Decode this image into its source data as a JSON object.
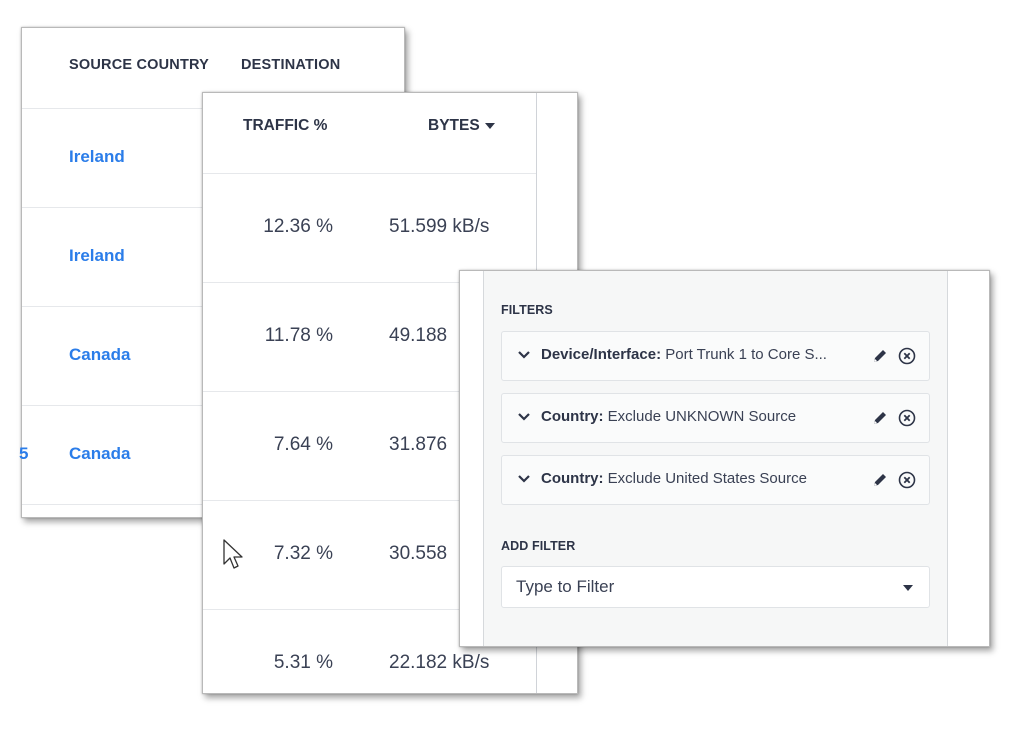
{
  "source_panel": {
    "headers": [
      "SOURCE COUNTRY",
      "DESTINATION"
    ],
    "rows": [
      {
        "country": "Ireland",
        "left_cut": ""
      },
      {
        "country": "Ireland",
        "left_cut": ""
      },
      {
        "country": "Canada",
        "left_cut": ""
      },
      {
        "country": "Canada",
        "left_cut": "5"
      }
    ]
  },
  "traffic_panel": {
    "headers": {
      "traffic": "TRAFFIC %",
      "bytes": "BYTES"
    },
    "sort_icon": "caret-down-icon",
    "rows": [
      {
        "traffic": "12.36 %",
        "bytes": "51.599 kB/s"
      },
      {
        "traffic": "11.78 %",
        "bytes": "49.188"
      },
      {
        "traffic": "7.64 %",
        "bytes": "31.876"
      },
      {
        "traffic": "7.32 %",
        "bytes": "30.558"
      },
      {
        "traffic": "5.31 %",
        "bytes": "22.182 kB/s"
      }
    ]
  },
  "filters_panel": {
    "filters_label": "FILTERS",
    "filters": [
      {
        "key": "Device/Interface:",
        "value": "Port Trunk 1 to Core S..."
      },
      {
        "key": "Country:",
        "value": "Exclude UNKNOWN Source"
      },
      {
        "key": "Country:",
        "value": "Exclude United States Source"
      }
    ],
    "add_filter_label": "ADD FILTER",
    "add_filter_placeholder": "Type to Filter"
  }
}
